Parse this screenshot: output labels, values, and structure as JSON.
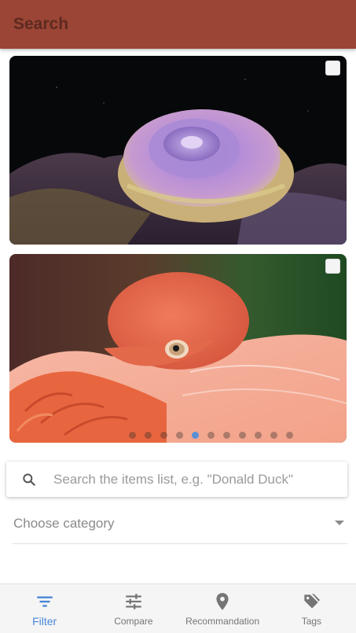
{
  "app_bar": {
    "title": "Search"
  },
  "cards": [
    {
      "subject": "coral",
      "checked": false
    },
    {
      "subject": "flamingo",
      "checked": false
    }
  ],
  "carousel": {
    "dot_count": 11,
    "active_index": 4
  },
  "search": {
    "placeholder": "Search the items list, e.g. \"Donald Duck\"",
    "value": "",
    "icon": "search-icon"
  },
  "category": {
    "label": "Choose category",
    "icon": "chevron-down-icon"
  },
  "bottom_nav": {
    "items": [
      {
        "label": "Filter",
        "icon": "filter-icon",
        "active": true
      },
      {
        "label": "Compare",
        "icon": "sliders-icon",
        "active": false
      },
      {
        "label": "Recommandation",
        "icon": "location-pin-icon",
        "active": false
      },
      {
        "label": "Tags",
        "icon": "tag-icon",
        "active": false
      }
    ]
  },
  "colors": {
    "app_bar": "#9a4535",
    "accent": "#4a86d8",
    "inactive": "#757575"
  }
}
